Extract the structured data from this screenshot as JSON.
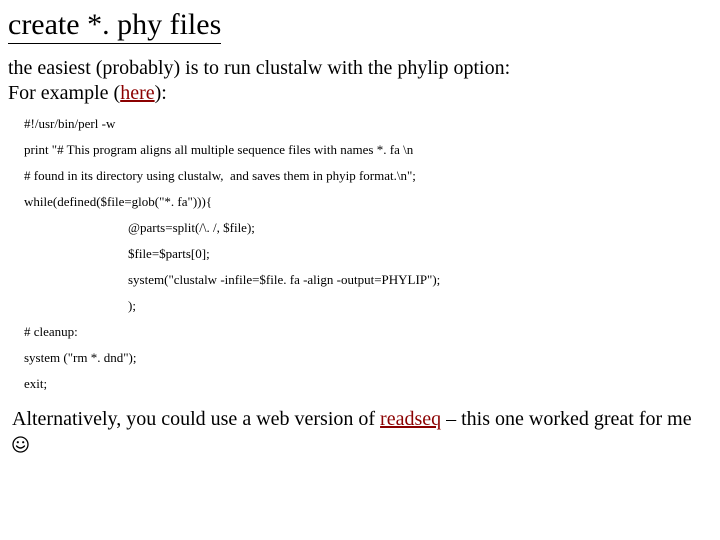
{
  "title": "create *. phy files",
  "intro": {
    "line1": "the easiest (probably) is to run clustalw with the phylip option:",
    "line2_prefix": "For example (",
    "line2_link": "here",
    "line2_suffix": "):"
  },
  "code": {
    "l1": "#!/usr/bin/perl -w",
    "l2": "print \"# This program aligns all multiple sequence files with names *. fa \\n",
    "l3": "# found in its directory using clustalw,  and saves them in phyip format.\\n\";",
    "l4": "while(defined($file=glob(\"*. fa\"))){",
    "l5": "@parts=split(/\\. /, $file);",
    "l6": "$file=$parts[0];",
    "l7": "system(\"clustalw -infile=$file. fa -align -output=PHYLIP\");",
    "l8": ");",
    "l9": "# cleanup:",
    "l10": "system (\"rm *. dnd\");",
    "l11": "exit;"
  },
  "closing": {
    "text1": "Alternatively, you could use a web version of ",
    "link": "readseq",
    "text2": " – this one worked great for me "
  }
}
